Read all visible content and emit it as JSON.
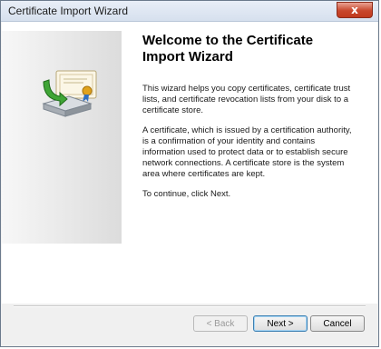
{
  "window": {
    "title": "Certificate Import Wizard",
    "close_symbol": "x"
  },
  "icons": {
    "wizard_art": "certificate-import-icon"
  },
  "main": {
    "heading": "Welcome to the Certificate Import Wizard",
    "paragraphs": [
      "This wizard helps you copy certificates, certificate trust lists, and certificate revocation lists from your disk to a certificate store.",
      "A certificate, which is issued by a certification authority, is a confirmation of your identity and contains information used to protect data or to establish secure network connections. A certificate store is the system area where certificates are kept.",
      "To continue, click Next."
    ]
  },
  "buttons": {
    "back": "< Back",
    "next": "Next >",
    "cancel": "Cancel"
  },
  "colors": {
    "close_button": "#c8462b",
    "side_panel": "#e6e6e6",
    "default_button_border": "#3c7fb1"
  }
}
